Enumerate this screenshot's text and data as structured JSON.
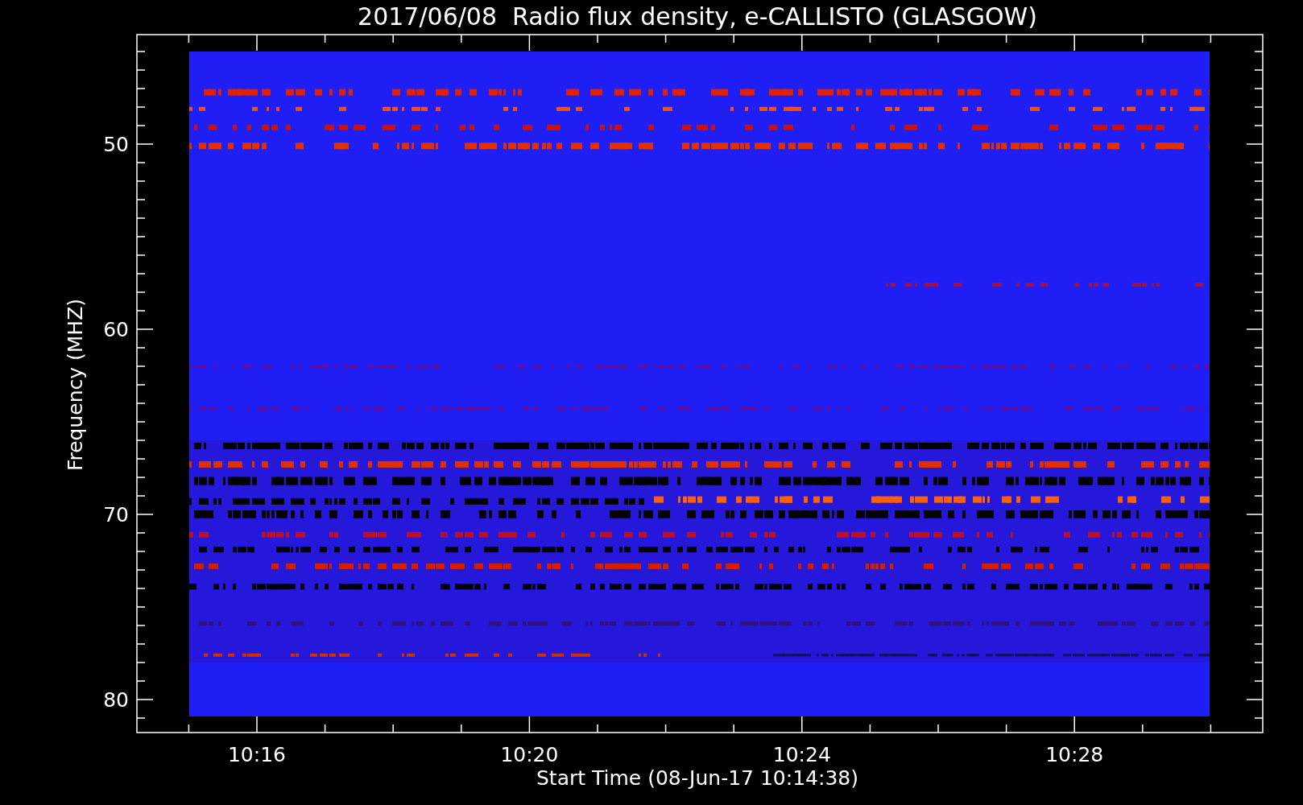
{
  "plot": {
    "title": "2017/06/08  Radio flux density, e-CALLISTO (GLASGOW)",
    "xlabel": "Start Time (08-Jun-17 10:14:38)",
    "ylabel": "Frequency (MHZ)",
    "xtick_labels": [
      "10:16",
      "10:20",
      "10:24",
      "10:28"
    ],
    "ytick_labels": [
      "50",
      "60",
      "70",
      "80"
    ]
  }
}
